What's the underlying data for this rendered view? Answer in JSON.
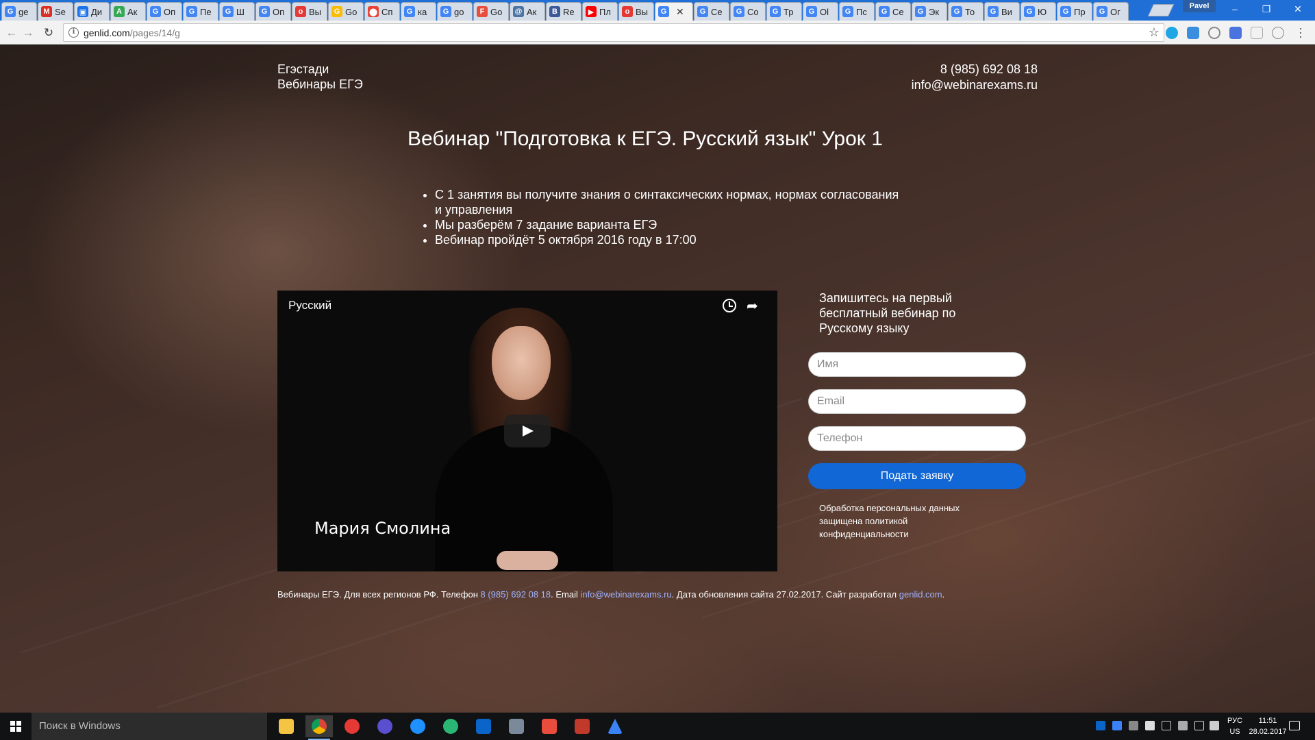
{
  "browser": {
    "tabs": [
      {
        "label": "ge",
        "icon": "google-icon",
        "color": "#4285f4",
        "glyph": "G"
      },
      {
        "label": "Se",
        "icon": "gmail-icon",
        "color": "#d93025",
        "glyph": "M"
      },
      {
        "label": "Ди",
        "icon": "chat-icon",
        "color": "#1a73e8",
        "glyph": "▣"
      },
      {
        "label": "Ак",
        "icon": "adwords-icon",
        "color": "#34a853",
        "glyph": "A"
      },
      {
        "label": "Оп",
        "icon": "google-icon",
        "color": "#4285f4",
        "glyph": "G"
      },
      {
        "label": "Пе",
        "icon": "google-icon",
        "color": "#4285f4",
        "glyph": "G"
      },
      {
        "label": "Ш",
        "icon": "google-icon",
        "color": "#4285f4",
        "glyph": "G"
      },
      {
        "label": "Оп",
        "icon": "google-icon",
        "color": "#4285f4",
        "glyph": "G"
      },
      {
        "label": "Вы",
        "icon": "site-icon",
        "color": "#e53935",
        "glyph": "o"
      },
      {
        "label": "Go",
        "icon": "drive-icon",
        "color": "#fbbc04",
        "glyph": "G"
      },
      {
        "label": "Сп",
        "icon": "maps-pin-icon",
        "color": "#ea4335",
        "glyph": "⬤"
      },
      {
        "label": "ка",
        "icon": "google-icon",
        "color": "#4285f4",
        "glyph": "G"
      },
      {
        "label": "go",
        "icon": "google-icon",
        "color": "#4285f4",
        "glyph": "G"
      },
      {
        "label": "Go",
        "icon": "fb-icon",
        "color": "#e94e3c",
        "glyph": "F"
      },
      {
        "label": "Ак",
        "icon": "vk-icon",
        "color": "#4c75a3",
        "glyph": "@"
      },
      {
        "label": "Re",
        "icon": "b-icon",
        "color": "#3b5998",
        "glyph": "B"
      },
      {
        "label": "Пл",
        "icon": "youtube-icon",
        "color": "#ff0000",
        "glyph": "▶"
      },
      {
        "label": "Вы",
        "icon": "site-icon",
        "color": "#e53935",
        "glyph": "o"
      },
      {
        "label": "",
        "icon": "google-icon",
        "color": "#4285f4",
        "glyph": "G",
        "active": true
      },
      {
        "label": "Се",
        "icon": "google-icon",
        "color": "#4285f4",
        "glyph": "G"
      },
      {
        "label": "Со",
        "icon": "google-icon",
        "color": "#4285f4",
        "glyph": "G"
      },
      {
        "label": "Тр",
        "icon": "google-icon",
        "color": "#4285f4",
        "glyph": "G"
      },
      {
        "label": "Ol",
        "icon": "google-icon",
        "color": "#4285f4",
        "glyph": "G"
      },
      {
        "label": "Пс",
        "icon": "google-icon",
        "color": "#4285f4",
        "glyph": "G"
      },
      {
        "label": "Се",
        "icon": "google-icon",
        "color": "#4285f4",
        "glyph": "G"
      },
      {
        "label": "Эк",
        "icon": "google-icon",
        "color": "#4285f4",
        "glyph": "G"
      },
      {
        "label": "То",
        "icon": "google-icon",
        "color": "#4285f4",
        "glyph": "G"
      },
      {
        "label": "Ви",
        "icon": "google-icon",
        "color": "#4285f4",
        "glyph": "G"
      },
      {
        "label": "Ю",
        "icon": "google-icon",
        "color": "#4285f4",
        "glyph": "G"
      },
      {
        "label": "Пр",
        "icon": "google-icon",
        "color": "#4285f4",
        "glyph": "G"
      },
      {
        "label": "Ог",
        "icon": "google-icon",
        "color": "#4285f4",
        "glyph": "G"
      }
    ],
    "user": "Pavel",
    "url_host": "genlid.com",
    "url_path": "/pages/14/g",
    "window": {
      "minimize": "–",
      "restore": "❐",
      "close": "✕"
    }
  },
  "site": {
    "brand_line1": "Егэстади",
    "brand_line2": "Вебинары ЕГЭ",
    "phone": "8 (985) 692 08 18",
    "email": "info@webinarexams.ru",
    "headline": "Вебинар \"Подготовка к ЕГЭ. Русский язык\" Урок 1",
    "bullets": [
      "С 1 занятия вы получите знания о синтаксических нормах, нормах согласования и управления",
      "Мы разберём 7 задание варианта ЕГЭ",
      "Вебинар пройдёт 5 октября 2016 году в 17:00"
    ],
    "video": {
      "title": "Русский",
      "caption": "Мария Смолина"
    },
    "form": {
      "title": "Запишитесь на первый бесплатный вебинар по Русскому языку",
      "name_placeholder": "Имя",
      "email_placeholder": "Email",
      "phone_placeholder": "Телефон",
      "submit": "Подать заявку",
      "privacy": "Обработка персональных данных защищена политикой конфиденциальности"
    },
    "footer": {
      "prefix": "Вебинары ЕГЭ. Для всех регионов РФ. Телефон ",
      "phone": "8 (985) 692 08 18",
      "mid": ". Email ",
      "email": "info@webinarexams.ru",
      "updated": ". Дата обновления сайта 27.02.2017. Сайт разработал ",
      "dev": "genlid.com",
      "end": "."
    }
  },
  "taskbar": {
    "search_placeholder": "Поиск в Windows",
    "lang_line1": "РУС",
    "lang_line2": "US",
    "time": "11:51",
    "date": "28.02.2017"
  }
}
